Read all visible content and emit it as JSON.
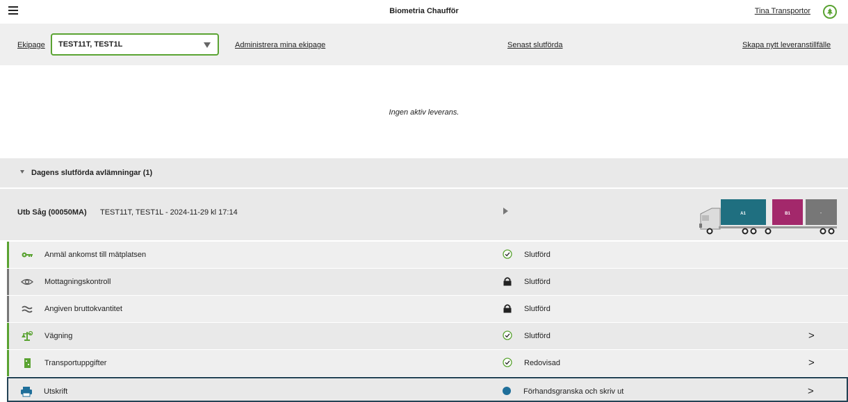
{
  "header": {
    "title": "Biometria Chaufför",
    "user": "Tina Transportor"
  },
  "toolbar": {
    "ekipage_label": "Ekipage",
    "ekipage_value": "TEST11T, TEST1L",
    "manage_link": "Administrera mina ekipage",
    "recent_link": "Senast slutförda",
    "create_link": "Skapa nytt leveranstillfälle"
  },
  "empty_message": "Ingen aktiv leverans.",
  "section": {
    "title": "Dagens slutförda avlämningar (1)"
  },
  "delivery": {
    "name": "Utb Såg (00050MA)",
    "info": "TEST11T, TEST1L - 2024-11-29 kl 17:14",
    "truck": {
      "compartments": [
        {
          "label": "A1",
          "color": "#1f6f80"
        },
        {
          "label": "B1",
          "color": "#a3286b"
        },
        {
          "label": "-",
          "color": "#777777"
        }
      ]
    }
  },
  "steps": [
    {
      "label": "Anmäl ankomst till mätplatsen",
      "icon": "key-icon",
      "status": "Slutförd",
      "status_icon": "check-circle-icon"
    },
    {
      "label": "Mottagningskontroll",
      "icon": "eye-icon",
      "status": "Slutförd",
      "status_icon": "lock-icon"
    },
    {
      "label": "Angiven bruttokvantitet",
      "icon": "approx-icon",
      "status": "Slutförd",
      "status_icon": "lock-icon"
    },
    {
      "label": "Vägning",
      "icon": "scale-icon",
      "status": "Slutförd",
      "status_icon": "check-circle-icon",
      "chevron": ">"
    },
    {
      "label": "Transportuppgifter",
      "icon": "document-icon",
      "status": "Redovisad",
      "status_icon": "check-circle-icon",
      "chevron": ">"
    },
    {
      "label": "Utskrift",
      "icon": "printer-icon",
      "status": "Förhandsgranska och skriv ut",
      "status_icon": "dot-icon",
      "chevron": ">"
    }
  ],
  "colors": {
    "accent": "#5aa332",
    "selected_border": "#234355",
    "status_dot": "#1f6f9a"
  }
}
